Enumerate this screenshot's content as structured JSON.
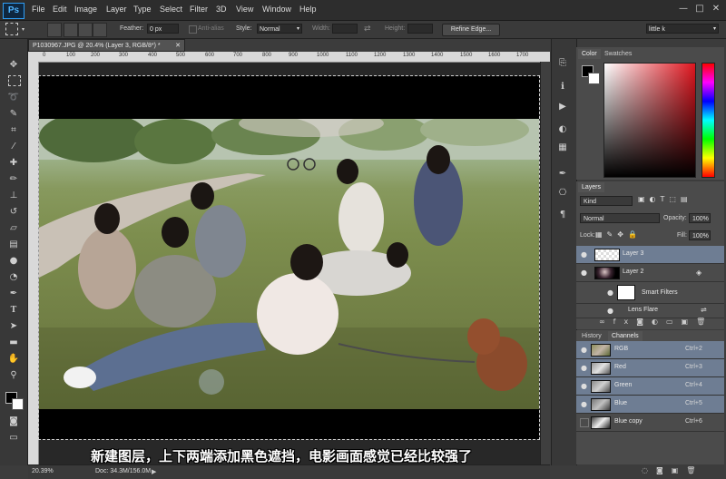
{
  "app": {
    "logo": "Ps"
  },
  "menu": [
    "File",
    "Edit",
    "Image",
    "Layer",
    "Type",
    "Select",
    "Filter",
    "3D",
    "View",
    "Window",
    "Help"
  ],
  "window_controls": {
    "minimize": "—",
    "restore": "□",
    "close": "✕"
  },
  "options": {
    "feather_label": "Feather:",
    "feather_value": "0 px",
    "antialias_label": "Anti-alias",
    "style_label": "Style:",
    "style_value": "Normal",
    "width_label": "Width:",
    "height_label": "Height:",
    "refine_edge": "Refine Edge...",
    "workspace": "little k"
  },
  "document": {
    "tab_title": "P1030967.JPG @ 20.4% (Layer 3, RGB/8*) *",
    "ruler_marks": [
      "0",
      "100",
      "200",
      "300",
      "400",
      "500",
      "600",
      "700",
      "800",
      "900",
      "1000",
      "1100",
      "1200",
      "1300",
      "1400",
      "1500",
      "1600",
      "1700"
    ]
  },
  "subtitle": "新建图层，上下两端添加黑色遮挡，电影画面感觉已经比较强了",
  "status": {
    "zoom": "20.39%",
    "doc": "Doc: 34.3M/156.0M"
  },
  "color_panel": {
    "tabs": [
      "Color",
      "Swatches"
    ]
  },
  "layers_panel": {
    "title": "Layers",
    "kind": "Kind",
    "blend_mode": "Normal",
    "opacity_label": "Opacity:",
    "opacity_value": "100%",
    "lock_label": "Lock:",
    "fill_label": "Fill:",
    "fill_value": "100%",
    "layers": [
      {
        "name": "Layer 3",
        "selected": true
      },
      {
        "name": "Layer 2",
        "selected": false
      },
      {
        "name": "Smart Filters",
        "selected": false
      },
      {
        "name": "Lens Flare",
        "selected": false
      }
    ]
  },
  "channels_panel": {
    "tabs": [
      "History",
      "Channels"
    ],
    "channels": [
      {
        "name": "RGB",
        "shortcut": "Ctrl+2",
        "selected": true
      },
      {
        "name": "Red",
        "shortcut": "Ctrl+3",
        "selected": true
      },
      {
        "name": "Green",
        "shortcut": "Ctrl+4",
        "selected": true
      },
      {
        "name": "Blue",
        "shortcut": "Ctrl+5",
        "selected": true
      },
      {
        "name": "Blue copy",
        "shortcut": "Ctrl+6",
        "selected": false
      }
    ]
  },
  "colors": {
    "accent": "#2f9ef5",
    "selected_row": "#6e7d93",
    "ui_dark": "#383838"
  }
}
